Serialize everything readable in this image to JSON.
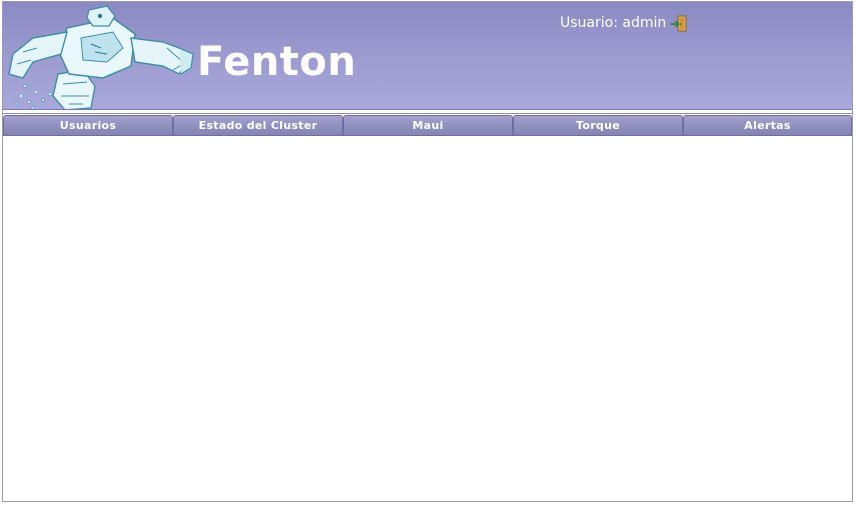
{
  "app": {
    "title": "Fenton"
  },
  "user": {
    "label": "Usuario: admin",
    "logout_icon": "logout-door-icon"
  },
  "nav": {
    "items": [
      {
        "label": "Usuarios"
      },
      {
        "label": "Estado del Cluster"
      },
      {
        "label": "Maui"
      },
      {
        "label": "Torque"
      },
      {
        "label": "Alertas"
      }
    ]
  },
  "colors": {
    "header": "#9c9bd0",
    "nav_tab": "#8f8ebd",
    "title_text": "#ffffff",
    "mascot": "#5fb4c9"
  }
}
